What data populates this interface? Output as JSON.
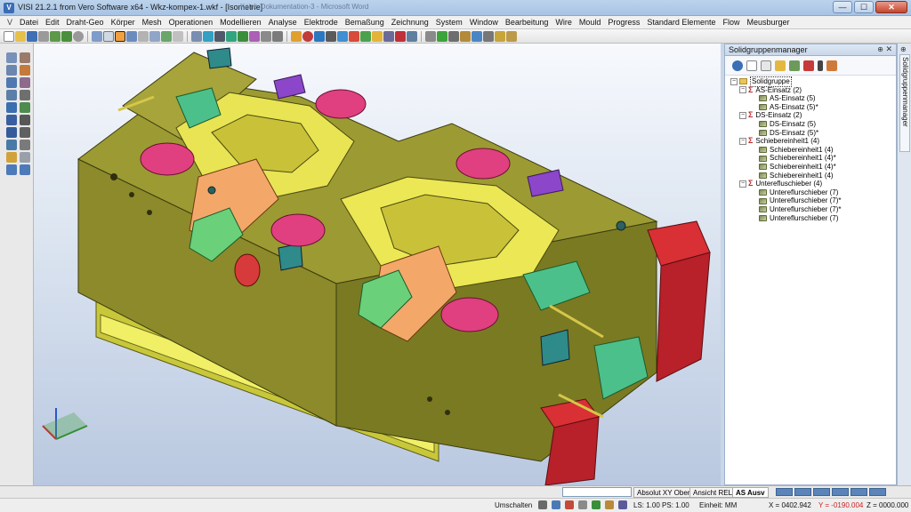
{
  "window": {
    "title": "VISI 21.2.1 from Vero Software x64 - Wkz-kompex-1.wkf - [Isometrie]",
    "ghost_title": "Keine Dokumentation-3 - Microsoft Word",
    "minimize": "—",
    "maximize": "☐",
    "close": "✕"
  },
  "menu": {
    "items": [
      "Datei",
      "Edit",
      "Draht-Geo",
      "Körper",
      "Mesh",
      "Operationen",
      "Modellieren",
      "Analyse",
      "Elektrode",
      "Bemaßung",
      "Zeichnung",
      "System",
      "Window",
      "Bearbeitung",
      "Wire",
      "Mould",
      "Progress",
      "Standard Elemente",
      "Flow",
      "Meusburger"
    ]
  },
  "panel": {
    "title": "Solidgruppenmanager",
    "pin": "⊕",
    "close": "✕",
    "vertical_tab": "Solidgruppenmanager",
    "tree": {
      "root": "Solidgruppe",
      "groups": [
        {
          "name": "AS-Einsatz (2)",
          "items": [
            "AS-Einsatz (5)",
            "AS-Einsatz (5)*"
          ]
        },
        {
          "name": "DS-Einsatz (2)",
          "items": [
            "DS-Einsatz (5)",
            "DS-Einsatz (5)*"
          ]
        },
        {
          "name": "Schiebereinheit1 (4)",
          "items": [
            "Schiebereinheit1 (4)",
            "Schiebereinheit1 (4)*",
            "Schiebereinheit1 (4)*",
            "Schiebereinheit1 (4)"
          ]
        },
        {
          "name": "Unterefluschieber (4)",
          "items": [
            "Untereflurschieber (7)",
            "Untereflurschieber (7)*",
            "Untereflurschieber (7)*",
            "Untereflurschieber (7)"
          ]
        }
      ]
    }
  },
  "status": {
    "view_tabs": [
      "Absolut XY Ober",
      "Ansicht REL",
      "AS Ausv"
    ],
    "active_tab": "AS Ausv",
    "umschalten": "Umschalten",
    "ls_ps": "LS: 1.00 PS: 1.00",
    "einheit": "Einheit: MM",
    "x_coord": "X = 0402.942",
    "y_coord": "Y = -0190.004",
    "z_coord": "Z = 0000.000"
  },
  "colors": {
    "mould_base": "#8c8a2a",
    "mould_light": "#e3e24a",
    "insert_pink": "#e0407f",
    "slider_orange": "#f3a86a",
    "green_parts": "#3fc38a",
    "red_block": "#c8242a",
    "purple_part": "#8b46c9",
    "viewport_bottom": "#b9c8e0"
  },
  "icons": {
    "app": "visi-logo-icon",
    "close": "close-icon"
  }
}
